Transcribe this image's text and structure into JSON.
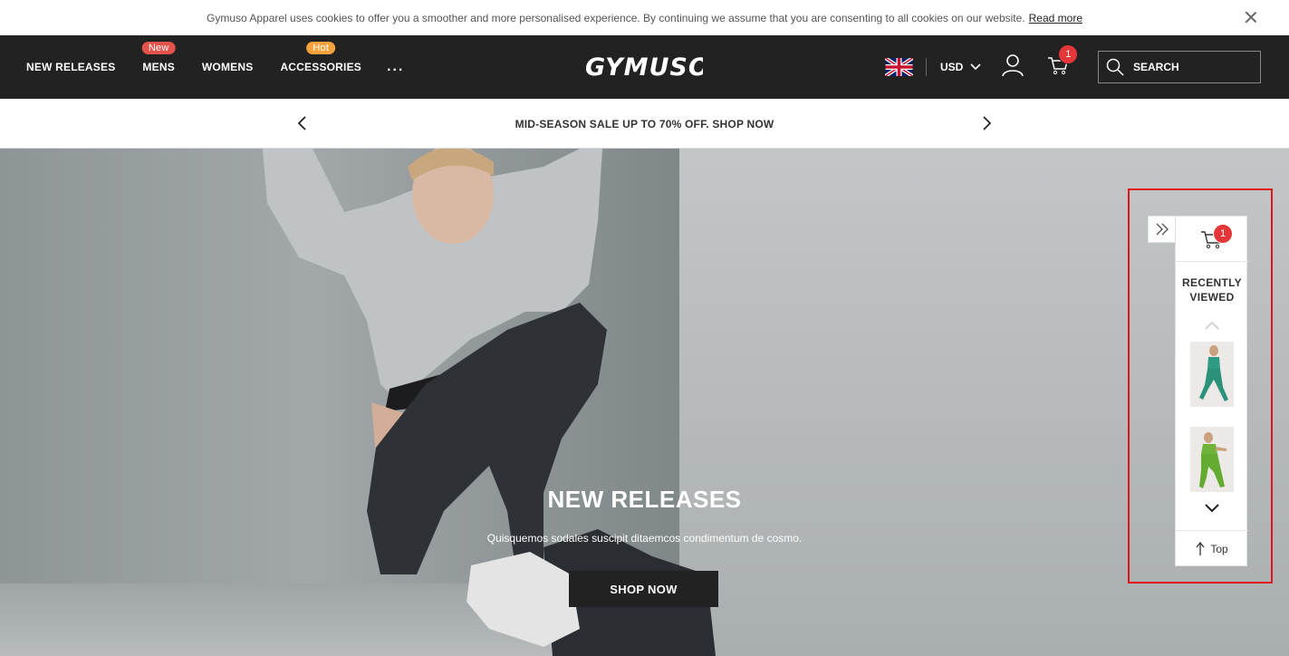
{
  "cookie_bar": {
    "message": "Gymuso Apparel uses cookies to offer you a smoother and more personalised experience. By continuing we assume that you are consenting to all cookies on our website.",
    "read_more": "Read more"
  },
  "nav": {
    "items": [
      {
        "label": "NEW RELEASES",
        "badge": ""
      },
      {
        "label": "MENS",
        "badge": "New"
      },
      {
        "label": "WOMENS",
        "badge": ""
      },
      {
        "label": "ACCESSORIES",
        "badge": "Hot"
      }
    ],
    "more": "..."
  },
  "logo": {
    "text": "GYMUSO"
  },
  "header": {
    "currency": "USD",
    "cart_count": "1",
    "search_placeholder": "SEARCH"
  },
  "promo": {
    "text": "MID-SEASON SALE UP TO 70% OFF. SHOP NOW"
  },
  "hero": {
    "title": "NEW RELEASES",
    "subtitle": "Quisquemos sodales suscipit ditaemcos condimentum de cosmo.",
    "button": "SHOP NOW"
  },
  "widget": {
    "cart_count": "1",
    "title_line1": "RECENTLY",
    "title_line2": "VIEWED",
    "top_label": "Top"
  },
  "colors": {
    "header_bg": "#222222",
    "badge_new": "#e4524b",
    "badge_hot": "#f5a13c",
    "cart_badge": "#e4373a",
    "highlight_border": "#e0141b"
  }
}
